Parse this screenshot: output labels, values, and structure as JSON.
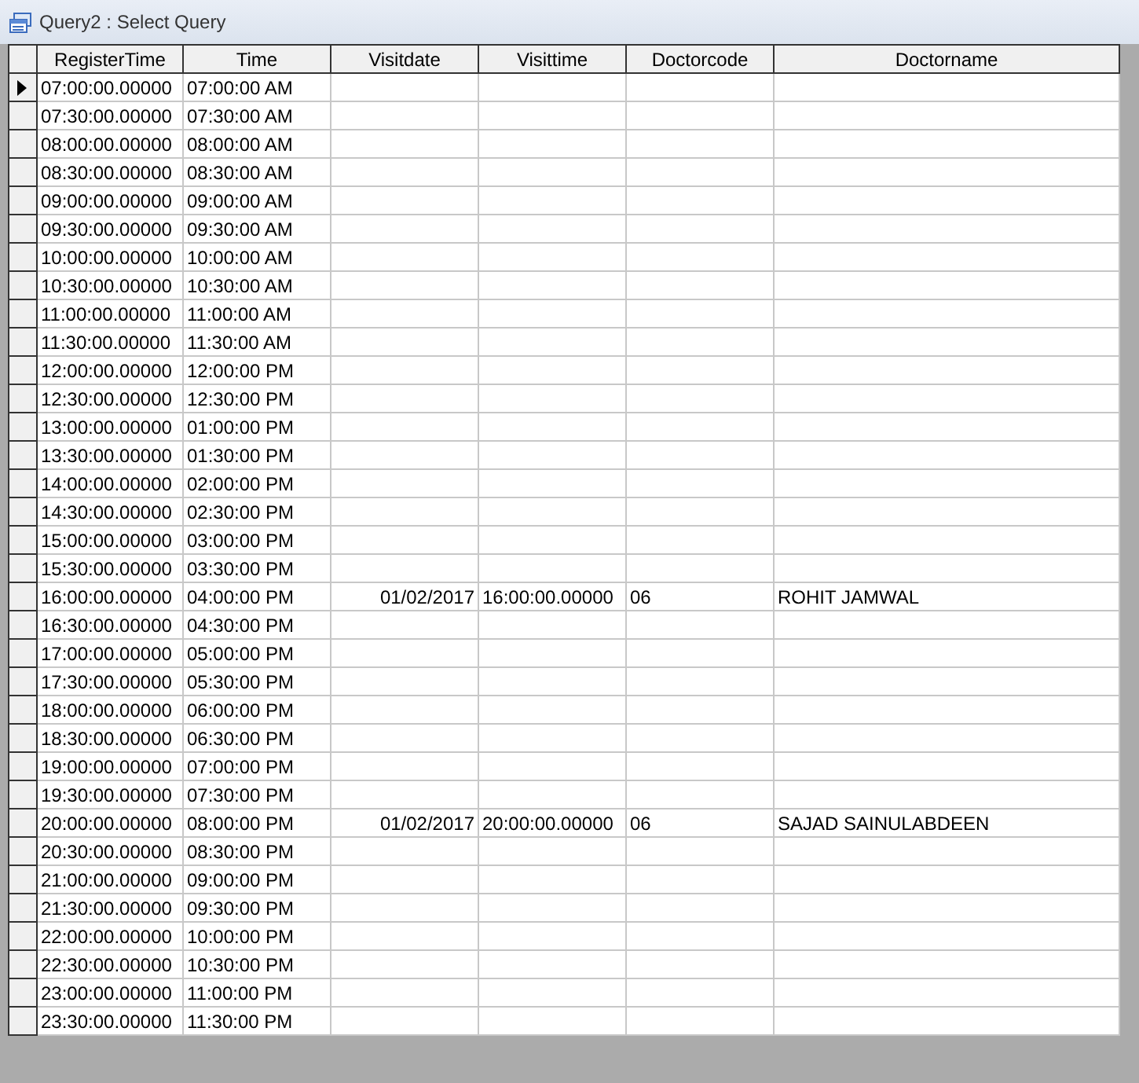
{
  "window": {
    "title": "Query2 : Select Query"
  },
  "table": {
    "columns": [
      "RegisterTime",
      "Time",
      "Visitdate",
      "Visittime",
      "Doctorcode",
      "Doctorname"
    ],
    "rows": [
      {
        "selected": true,
        "register_time": "07:00:00.00000",
        "time": "07:00:00 AM"
      },
      {
        "selected": false,
        "register_time": "07:30:00.00000",
        "time": "07:30:00 AM"
      },
      {
        "selected": false,
        "register_time": "08:00:00.00000",
        "time": "08:00:00 AM"
      },
      {
        "selected": false,
        "register_time": "08:30:00.00000",
        "time": "08:30:00 AM"
      },
      {
        "selected": false,
        "register_time": "09:00:00.00000",
        "time": "09:00:00 AM"
      },
      {
        "selected": false,
        "register_time": "09:30:00.00000",
        "time": "09:30:00 AM"
      },
      {
        "selected": false,
        "register_time": "10:00:00.00000",
        "time": "10:00:00 AM"
      },
      {
        "selected": false,
        "register_time": "10:30:00.00000",
        "time": "10:30:00 AM"
      },
      {
        "selected": false,
        "register_time": "11:00:00.00000",
        "time": "11:00:00 AM"
      },
      {
        "selected": false,
        "register_time": "11:30:00.00000",
        "time": "11:30:00 AM"
      },
      {
        "selected": false,
        "register_time": "12:00:00.00000",
        "time": "12:00:00 PM"
      },
      {
        "selected": false,
        "register_time": "12:30:00.00000",
        "time": "12:30:00 PM"
      },
      {
        "selected": false,
        "register_time": "13:00:00.00000",
        "time": "01:00:00 PM"
      },
      {
        "selected": false,
        "register_time": "13:30:00.00000",
        "time": "01:30:00 PM"
      },
      {
        "selected": false,
        "register_time": "14:00:00.00000",
        "time": "02:00:00 PM"
      },
      {
        "selected": false,
        "register_time": "14:30:00.00000",
        "time": "02:30:00 PM"
      },
      {
        "selected": false,
        "register_time": "15:00:00.00000",
        "time": "03:00:00 PM"
      },
      {
        "selected": false,
        "register_time": "15:30:00.00000",
        "time": "03:30:00 PM"
      },
      {
        "selected": false,
        "register_time": "16:00:00.00000",
        "time": "04:00:00 PM",
        "visitdate": "01/02/2017",
        "visittime": "16:00:00.00000",
        "doctorcode": "06",
        "doctorname": "ROHIT JAMWAL"
      },
      {
        "selected": false,
        "register_time": "16:30:00.00000",
        "time": "04:30:00 PM"
      },
      {
        "selected": false,
        "register_time": "17:00:00.00000",
        "time": "05:00:00 PM"
      },
      {
        "selected": false,
        "register_time": "17:30:00.00000",
        "time": "05:30:00 PM"
      },
      {
        "selected": false,
        "register_time": "18:00:00.00000",
        "time": "06:00:00 PM"
      },
      {
        "selected": false,
        "register_time": "18:30:00.00000",
        "time": "06:30:00 PM"
      },
      {
        "selected": false,
        "register_time": "19:00:00.00000",
        "time": "07:00:00 PM"
      },
      {
        "selected": false,
        "register_time": "19:30:00.00000",
        "time": "07:30:00 PM"
      },
      {
        "selected": false,
        "register_time": "20:00:00.00000",
        "time": "08:00:00 PM",
        "visitdate": "01/02/2017",
        "visittime": "20:00:00.00000",
        "doctorcode": "06",
        "doctorname": "SAJAD SAINULABDEEN"
      },
      {
        "selected": false,
        "register_time": "20:30:00.00000",
        "time": "08:30:00 PM"
      },
      {
        "selected": false,
        "register_time": "21:00:00.00000",
        "time": "09:00:00 PM"
      },
      {
        "selected": false,
        "register_time": "21:30:00.00000",
        "time": "09:30:00 PM"
      },
      {
        "selected": false,
        "register_time": "22:00:00.00000",
        "time": "10:00:00 PM"
      },
      {
        "selected": false,
        "register_time": "22:30:00.00000",
        "time": "10:30:00 PM"
      },
      {
        "selected": false,
        "register_time": "23:00:00.00000",
        "time": "11:00:00 PM"
      },
      {
        "selected": false,
        "register_time": "23:30:00.00000",
        "time": "11:30:00 PM"
      }
    ]
  }
}
